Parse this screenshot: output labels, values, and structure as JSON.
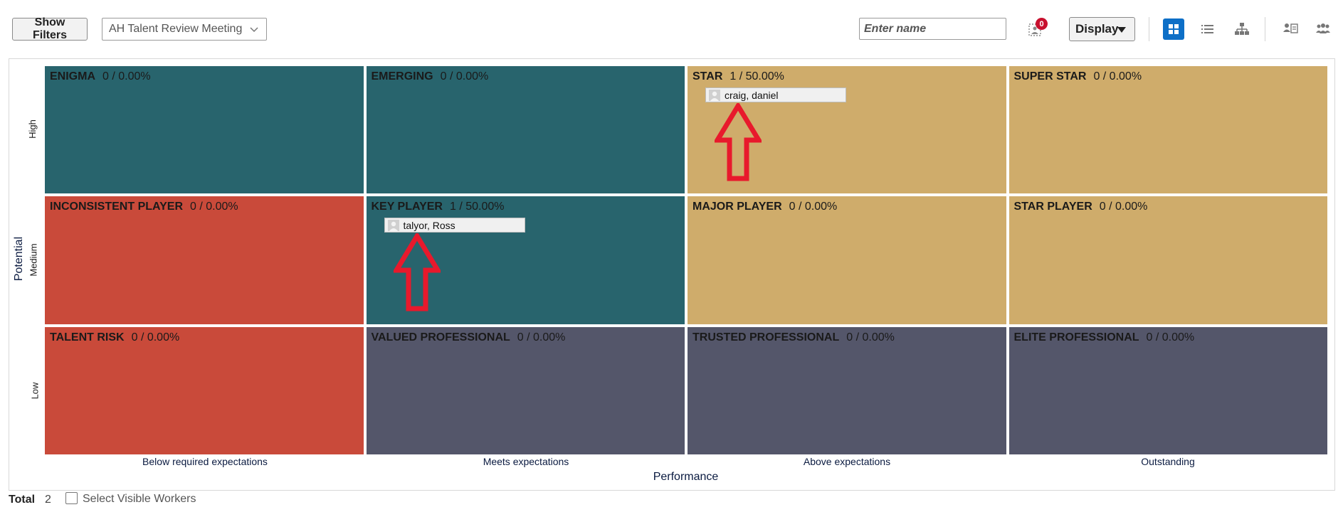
{
  "toolbar": {
    "show_filters_label": "Show Filters",
    "meeting_select_value": "AH Talent Review Meeting",
    "name_input_placeholder": "Enter name",
    "selected_badge_count": "0",
    "display_label": "Display",
    "icons": [
      "grid-view-icon",
      "list-view-icon",
      "hierarchy-view-icon",
      "compare-workers-icon",
      "team-icon"
    ]
  },
  "matrix": {
    "y_title": "Potential",
    "x_title": "Performance",
    "rows": [
      "High",
      "Medium",
      "Low"
    ],
    "columns": [
      "Below required expectations",
      "Meets expectations",
      "Above expectations",
      "Outstanding"
    ],
    "colors": {
      "teal": "#28646d",
      "red": "#c94a3a",
      "gold": "#cfac6b",
      "slate": "#54566a",
      "arrow": "#e8192c"
    },
    "cells": [
      {
        "title": "ENIGMA",
        "count": "0 / 0.00%",
        "color": "#28646d",
        "workers": []
      },
      {
        "title": "EMERGING",
        "count": "0 / 0.00%",
        "color": "#28646d",
        "workers": []
      },
      {
        "title": "STAR",
        "count": "1 / 50.00%",
        "color": "#cfac6b",
        "workers": [
          "craig, daniel"
        ]
      },
      {
        "title": "SUPER STAR",
        "count": "0 / 0.00%",
        "color": "#cfac6b",
        "workers": []
      },
      {
        "title": "INCONSISTENT PLAYER",
        "count": "0 / 0.00%",
        "color": "#c94a3a",
        "workers": []
      },
      {
        "title": "KEY PLAYER",
        "count": "1 / 50.00%",
        "color": "#28646d",
        "workers": [
          "talyor, Ross"
        ]
      },
      {
        "title": "MAJOR PLAYER",
        "count": "0 / 0.00%",
        "color": "#cfac6b",
        "workers": []
      },
      {
        "title": "STAR PLAYER",
        "count": "0 / 0.00%",
        "color": "#cfac6b",
        "workers": []
      },
      {
        "title": "TALENT RISK",
        "count": "0 / 0.00%",
        "color": "#c94a3a",
        "workers": []
      },
      {
        "title": "VALUED PROFESSIONAL",
        "count": "0 / 0.00%",
        "color": "#54566a",
        "workers": []
      },
      {
        "title": "TRUSTED PROFESSIONAL",
        "count": "0 / 0.00%",
        "color": "#54566a",
        "workers": []
      },
      {
        "title": "ELITE PROFESSIONAL",
        "count": "0 / 0.00%",
        "color": "#54566a",
        "workers": []
      }
    ]
  },
  "footer": {
    "total_label": "Total",
    "total_count": "2",
    "select_visible_label": "Select Visible Workers"
  }
}
